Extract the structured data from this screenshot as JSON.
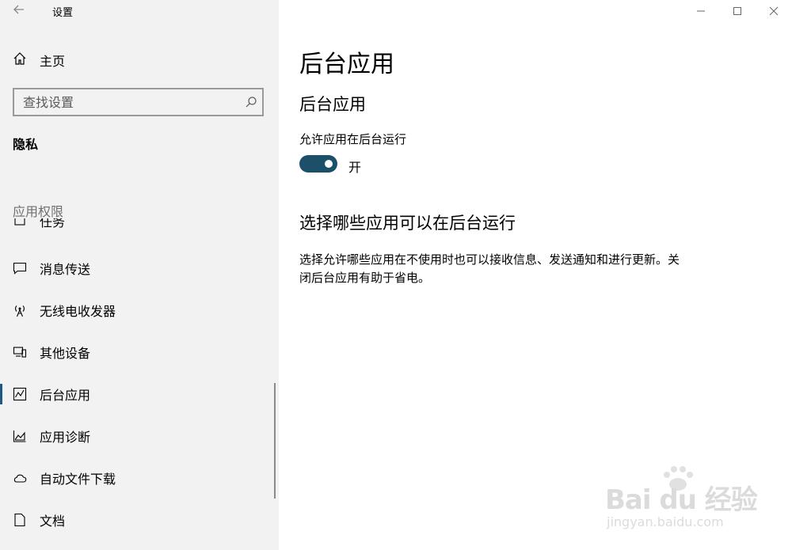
{
  "window": {
    "title": "设置"
  },
  "sidebar": {
    "home_label": "主页",
    "search_placeholder": "查找设置",
    "section_title": "隐私",
    "group_title": "应用权限",
    "clipped_item_label": "任务",
    "items": [
      {
        "label": "消息传送",
        "icon": "chat-icon"
      },
      {
        "label": "无线电收发器",
        "icon": "radio-tower-icon"
      },
      {
        "label": "其他设备",
        "icon": "devices-icon"
      },
      {
        "label": "后台应用",
        "icon": "background-apps-icon",
        "selected": true
      },
      {
        "label": "应用诊断",
        "icon": "diagnostics-icon"
      },
      {
        "label": "自动文件下载",
        "icon": "cloud-icon"
      },
      {
        "label": "文档",
        "icon": "document-icon"
      }
    ]
  },
  "main": {
    "page_title": "后台应用",
    "section_title": "后台应用",
    "toggle_label": "允许应用在后台运行",
    "toggle_state": "开",
    "toggle_on": true,
    "choose_title": "选择哪些应用可以在后台运行",
    "description": "选择允许哪些应用在不使用时也可以接收信息、发送通知和进行更新。关闭后台应用有助于省电。"
  },
  "watermark": {
    "brand": "Bai du 经验",
    "url": "jingyan.baidu.com"
  },
  "colors": {
    "accent": "#1c4f68",
    "sidebar_bg": "#f2f2f2",
    "selected_bar": "#1c5a83"
  }
}
